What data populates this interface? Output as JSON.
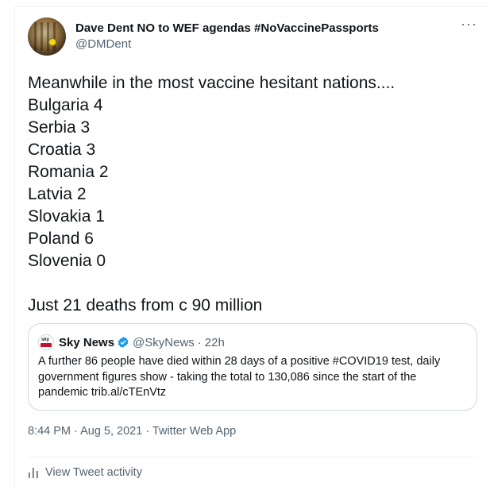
{
  "tweet": {
    "display_name": "Dave Dent NO to WEF agendas #NoVaccinePassports",
    "handle": "@DMDent",
    "more_icon": "more-icon",
    "text": "Meanwhile in the most vaccine hesitant nations....\nBulgaria 4\nSerbia 3\nCroatia 3\nRomania 2\nLatvia 2\nSlovakia 1\nPoland 6\nSlovenia 0\n\nJust 21 deaths from c 90 million",
    "timestamp": "8:44 PM · Aug 5, 2021 · Twitter Web App"
  },
  "quoted": {
    "name": "Sky News",
    "handle": "@SkyNews",
    "separator": "·",
    "time": "22h",
    "text": "A further 86 people have died within 28 days of a positive #COVID19 test, daily government figures show - taking the total to 130,086 since the start of the pandemic trib.al/cTEnVtz",
    "verified_color": "#1d9bf0"
  },
  "activity": {
    "label": "View Tweet activity",
    "icon": "bar-chart-icon"
  }
}
